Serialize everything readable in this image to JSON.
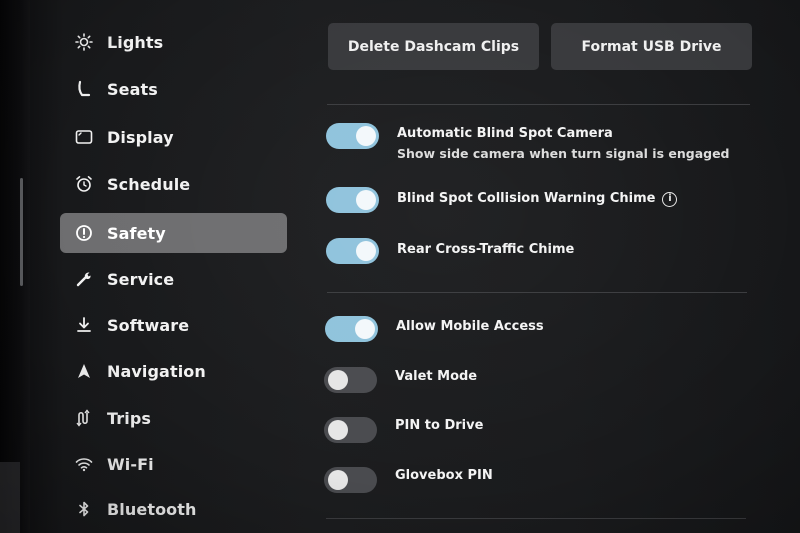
{
  "sidebar": {
    "items": [
      {
        "label": "Lights",
        "icon": "sun-icon"
      },
      {
        "label": "Seats",
        "icon": "seat-icon"
      },
      {
        "label": "Display",
        "icon": "display-icon"
      },
      {
        "label": "Schedule",
        "icon": "alarm-clock-icon"
      },
      {
        "label": "Safety",
        "icon": "alert-circle-icon",
        "active": true
      },
      {
        "label": "Service",
        "icon": "wrench-icon"
      },
      {
        "label": "Software",
        "icon": "download-icon"
      },
      {
        "label": "Navigation",
        "icon": "navigation-arrow-icon"
      },
      {
        "label": "Trips",
        "icon": "trips-icon"
      },
      {
        "label": "Wi-Fi",
        "icon": "wifi-icon"
      },
      {
        "label": "Bluetooth",
        "icon": "bluetooth-icon"
      }
    ]
  },
  "actions": {
    "delete_dashcam": "Delete Dashcam Clips",
    "format_usb": "Format USB Drive"
  },
  "settings": {
    "blind_spot_camera": {
      "title": "Automatic Blind Spot Camera",
      "description": "Show side camera when turn signal is engaged",
      "enabled": true
    },
    "collision_chime": {
      "title": "Blind Spot Collision Warning Chime",
      "enabled": true
    },
    "rear_cross_traffic": {
      "title": "Rear Cross-Traffic Chime",
      "enabled": true
    },
    "mobile_access": {
      "title": "Allow Mobile Access",
      "enabled": true
    },
    "valet_mode": {
      "title": "Valet Mode",
      "enabled": false
    },
    "pin_to_drive": {
      "title": "PIN to Drive",
      "enabled": false
    },
    "glovebox_pin": {
      "title": "Glovebox PIN",
      "enabled": false
    }
  },
  "colors": {
    "toggle_on": "#8fc3dc",
    "toggle_off": "#4a4b4f",
    "active_item": "#6e6e70",
    "button_bg": "#38393c"
  }
}
